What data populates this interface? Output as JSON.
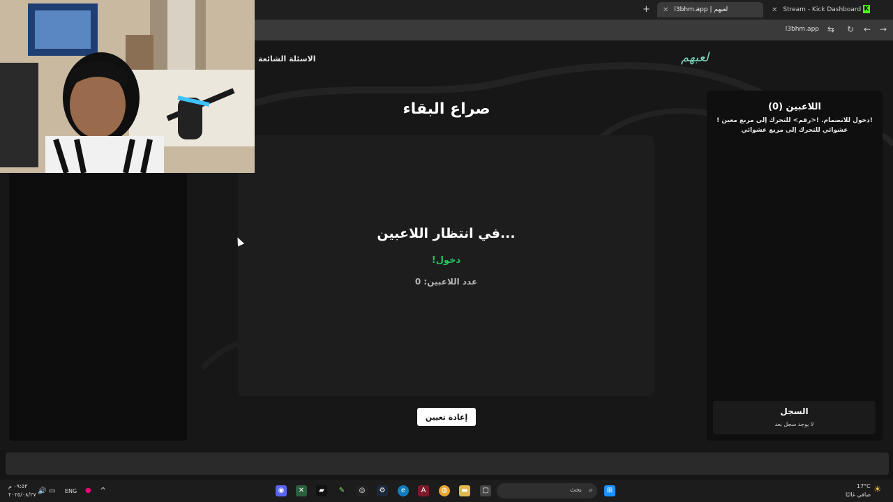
{
  "browser": {
    "tabs": [
      {
        "title": "Stream - Kick Dashboard",
        "active": false
      },
      {
        "title": "l3bhm.app | لعبهم",
        "active": true
      }
    ],
    "url": "l3bhm.app"
  },
  "site": {
    "logo": "لعبهم",
    "nav_faq": "الاسئلة الشائعة",
    "game_title": "صراع البقاء",
    "waiting_title": "في انتظار اللاعبين...",
    "join_command": "!دخول",
    "player_count_label": "عدد اللاعبين: 0",
    "reset_button": "إعادة تعيين",
    "players_panel": {
      "title": "اللاعبين (0)",
      "help": "!دخول للانضمام. !<رقم> للتحرك إلى مربع معين !عشوائي للتحرك إلى مربع عشوائي"
    },
    "log": {
      "title": "السجل",
      "empty": "لا يوجد سجل بعد"
    },
    "accent": "#22c55e",
    "logo_color": "#7ed7bf"
  },
  "taskbar": {
    "search_placeholder": "بحث",
    "language": "ENG",
    "weather_temp": "17°C",
    "weather_desc": "صافي غالبًا",
    "time": "٠٩:٥٣ م",
    "date": "٢٠٢٥/٠٨/٢٧"
  }
}
